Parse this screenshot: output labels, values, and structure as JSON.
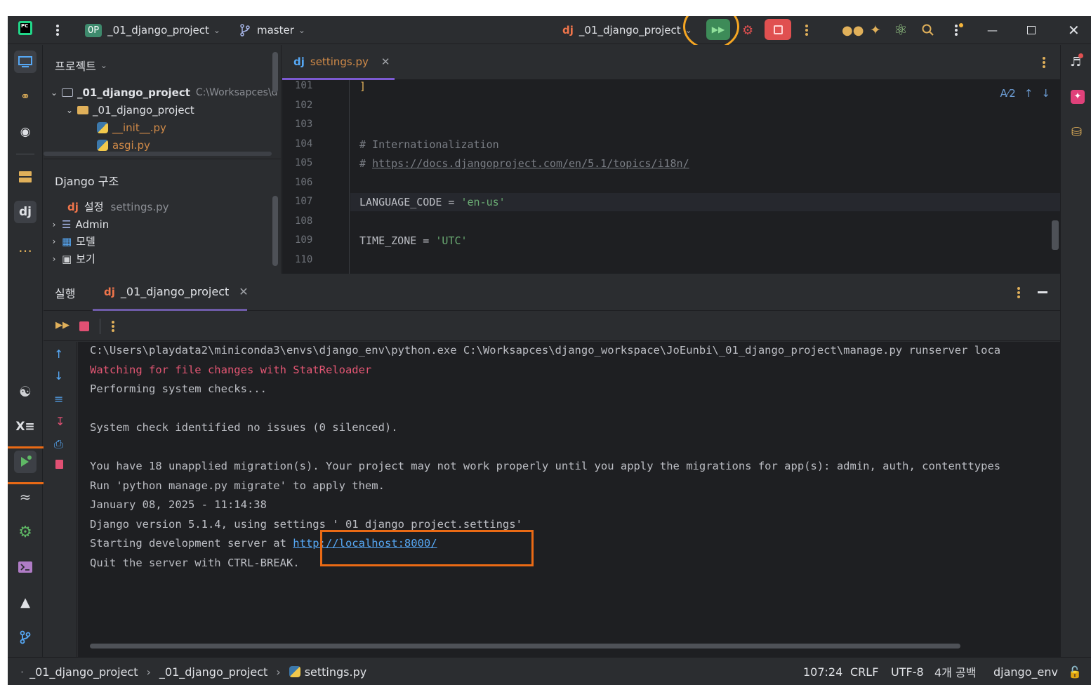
{
  "titlebar": {
    "project_badge": "0P",
    "project_name": "_01_django_project",
    "branch": "master",
    "run_config": "_01_django_project"
  },
  "project_panel": {
    "title": "프로젝트",
    "tree": [
      {
        "label": "_01_django_project",
        "hint": "C:\\Worksapces\\d"
      },
      {
        "label": "_01_django_project"
      },
      {
        "label": "__init__.py"
      },
      {
        "label": "asgi.py"
      }
    ]
  },
  "django_panel": {
    "title": "Django 구조",
    "items": [
      {
        "label": "설정",
        "hint": "settings.py"
      },
      {
        "label": "Admin"
      },
      {
        "label": "모델"
      },
      {
        "label": "보기"
      }
    ]
  },
  "editor": {
    "tab_label": "settings.py",
    "inspection_count": "2",
    "lines": [
      {
        "num": "101",
        "text": "]"
      },
      {
        "num": "102",
        "text": ""
      },
      {
        "num": "103",
        "text": ""
      },
      {
        "num": "104",
        "text": "# Internationalization"
      },
      {
        "num": "105",
        "text": "# https://docs.djangoproject.com/en/5.1/topics/i18n/"
      },
      {
        "num": "106",
        "text": ""
      },
      {
        "num": "107",
        "text": "LANGUAGE_CODE = 'en-us'"
      },
      {
        "num": "108",
        "text": ""
      },
      {
        "num": "109",
        "text": "TIME_ZONE = 'UTC'"
      },
      {
        "num": "110",
        "text": ""
      }
    ],
    "comment_prefix": "# ",
    "doc_link": "https://docs.djangoproject.com/en/5.1/topics/i18n/",
    "lang_key": "LANGUAGE_CODE = ",
    "lang_val": "'en-us'",
    "tz_key": "TIME_ZONE = ",
    "tz_val": "'UTC'"
  },
  "run_panel": {
    "title": "실행",
    "tab_label": "_01_django_project",
    "console": {
      "cmd": "C:\\Users\\playdata2\\miniconda3\\envs\\django_env\\python.exe C:\\Worksapces\\django_workspace\\JoEunbi\\_01_django_project\\manage.py runserver loca",
      "watching": "Watching for file changes with StatReloader",
      "checks": "Performing system checks...",
      "no_issues": "System check identified no issues (0 silenced).",
      "migrations": "You have 18 unapplied migration(s). Your project may not work properly until you apply the migrations for app(s): admin, auth, contenttypes",
      "migrate_hint": "Run 'python manage.py migrate' to apply them.",
      "timestamp": "January 08, 2025 - 11:14:38",
      "version": "Django version 5.1.4, using settings '_01_django_project.settings'",
      "starting": "Starting development server at ",
      "server_url": "http://localhost:8000/",
      "quit": "Quit the server with CTRL-BREAK."
    }
  },
  "statusbar": {
    "crumbs": [
      "_01_django_project",
      "_01_django_project",
      "settings.py"
    ],
    "position": "107:24",
    "line_sep": "CRLF",
    "encoding": "UTF-8",
    "indent": "4개 공백",
    "interpreter": "django_env"
  },
  "colors": {
    "annotation_orange": "#ea6a15",
    "annotation_yellow": "#f5a623",
    "run_green": "#3d8b58",
    "stop_red": "#e05050"
  }
}
